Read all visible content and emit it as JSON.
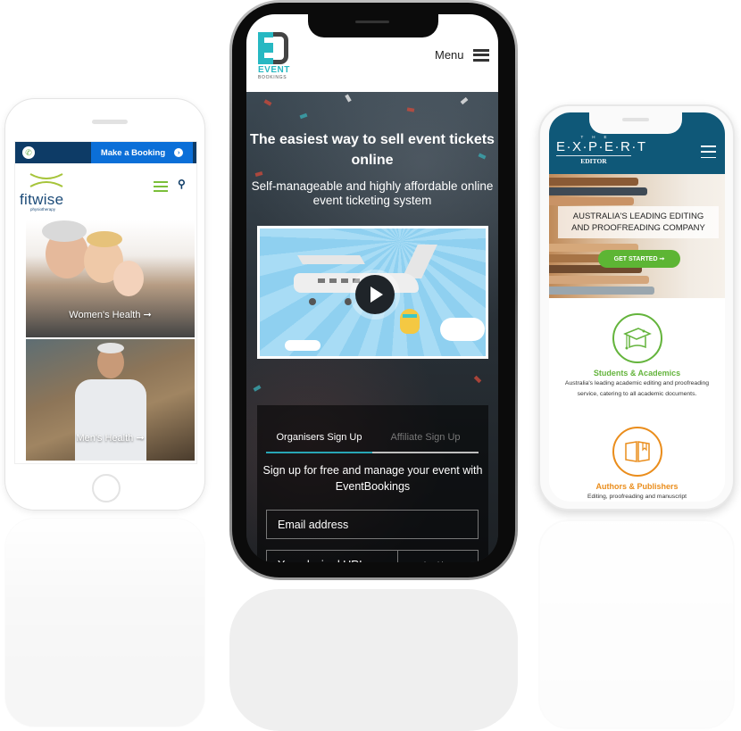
{
  "left_phone": {
    "brand": "fitwise",
    "brand_subtitle": "physiotherapy",
    "topbar": {
      "phone_icon": "phone-icon",
      "booking_label": "Make a Booking",
      "booking_arrow": "›"
    },
    "header": {
      "menu_icon": "hamburger-icon",
      "search_icon": "⚲"
    },
    "cards": [
      {
        "label": "Women's Health ➞"
      },
      {
        "label": "Men's Health ➞"
      }
    ],
    "colors": {
      "navy": "#0d3b66",
      "blue": "#0b6fd8",
      "green": "#7bbf3a"
    }
  },
  "center_phone": {
    "logo": {
      "word1": "EVENT",
      "word2": "BOOKINGS"
    },
    "menu_label": "Menu",
    "hero": {
      "title": "The easiest way to sell event tickets online",
      "subtitle": "Self-manageable and highly affordable online event ticketing system"
    },
    "signup": {
      "tabs": [
        {
          "label": "Organisers Sign Up",
          "active": true
        },
        {
          "label": "Affiliate Sign Up",
          "active": false
        }
      ],
      "text": "Sign up for free and manage your event with EventBookings",
      "email_placeholder": "Email address",
      "url_placeholder": "Your desired URL",
      "url_suffix": ".eventbookings.com"
    },
    "colors": {
      "teal": "#27b8c2",
      "dark": "#444444"
    }
  },
  "right_phone": {
    "logo": {
      "the": "THE",
      "expert": "E·X·P·E·R·T",
      "editor": "EDITOR"
    },
    "hero": {
      "banner_line1": "AUSTRALIA'S LEADING EDITING",
      "banner_line2": "AND PROOFREADING COMPANY",
      "cta_label": "GET STARTED ➞"
    },
    "services": [
      {
        "title": "Students & Academics",
        "description": "Australia's leading academic editing and proofreading service, catering to all academic documents.",
        "icon": "graduation-cap-icon"
      },
      {
        "title": "Authors & Publishers",
        "description": "Editing, proofreading and manuscript",
        "icon": "open-book-icon"
      }
    ],
    "colors": {
      "header": "#0f5878",
      "green": "#64b43c",
      "orange": "#ea8d1c"
    }
  }
}
